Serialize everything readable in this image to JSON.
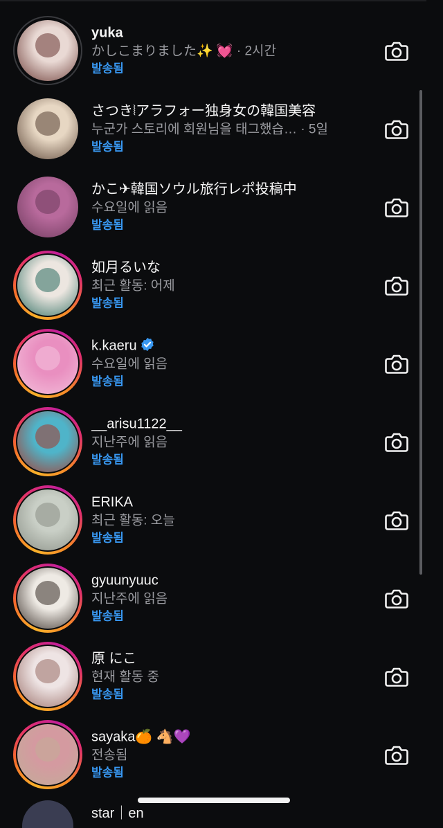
{
  "threads": [
    {
      "name": "yuka",
      "bold": true,
      "subtitle": "かしこまりました✨ 💓 · 2시간",
      "status": "발송됨",
      "ring": "seen",
      "verified": false,
      "avatar_colors": [
        "#e9d9d4",
        "#6b3b36"
      ]
    },
    {
      "name": "さつき⦚アラフォー独身女の韓国美容",
      "bold": false,
      "subtitle": "누군가 스토리에 회원님을 태그했습…  · 5일",
      "status": "발송됨",
      "ring": "none",
      "verified": false,
      "avatar_colors": [
        "#e7d7c3",
        "#5a4436"
      ]
    },
    {
      "name": "かこ✈韓国ソウル旅行レポ投稿中",
      "bold": false,
      "subtitle": "수요일에 읽음",
      "status": "발송됨",
      "ring": "none",
      "verified": false,
      "avatar_colors": [
        "#b86a9c",
        "#6d3a5c"
      ]
    },
    {
      "name": "如月るいな",
      "bold": false,
      "subtitle": "최근 활동: 어제",
      "status": "발송됨",
      "ring": "story",
      "verified": false,
      "avatar_colors": [
        "#ece6e0",
        "#2f6e62"
      ]
    },
    {
      "name": "k.kaeru",
      "bold": false,
      "subtitle": "수요일에 읽음",
      "status": "발송됨",
      "ring": "story",
      "verified": true,
      "avatar_colors": [
        "#e98fc0",
        "#f4c2dc"
      ]
    },
    {
      "name": "__arisu1122__",
      "bold": false,
      "subtitle": "지난주에 읽음",
      "status": "발송됨",
      "ring": "story",
      "verified": false,
      "avatar_colors": [
        "#4fb4c9",
        "#a83a2e"
      ]
    },
    {
      "name": "ERIKA",
      "bold": false,
      "subtitle": "최근 활동: 오늘",
      "status": "발송됨",
      "ring": "story",
      "verified": false,
      "avatar_colors": [
        "#c9cfc6",
        "#8a8f86"
      ]
    },
    {
      "name": "gyuunyuuc",
      "bold": false,
      "subtitle": "지난주에 읽음",
      "status": "발송됨",
      "ring": "story",
      "verified": false,
      "avatar_colors": [
        "#eeeae4",
        "#3a302a"
      ]
    },
    {
      "name": "原 にこ",
      "bold": false,
      "subtitle": "현재 활동 중",
      "status": "발송됨",
      "ring": "story",
      "verified": false,
      "avatar_colors": [
        "#eee4e4",
        "#9a6f68"
      ]
    },
    {
      "name": "sayaka🍊 🐴💜",
      "bold": false,
      "subtitle": "전송됨",
      "status": "발송됨",
      "ring": "story",
      "verified": false,
      "avatar_colors": [
        "#d49aa0",
        "#c2ad98"
      ]
    }
  ],
  "partial_thread": {
    "name": "star｜en"
  },
  "colors": {
    "background": "#0b0c0e",
    "sent_status": "#3897f0",
    "secondary_text": "#9a9ba0",
    "verified_badge": "#3897f0"
  },
  "icons": {
    "row_action": "camera-icon",
    "verified": "verified-badge-icon"
  }
}
